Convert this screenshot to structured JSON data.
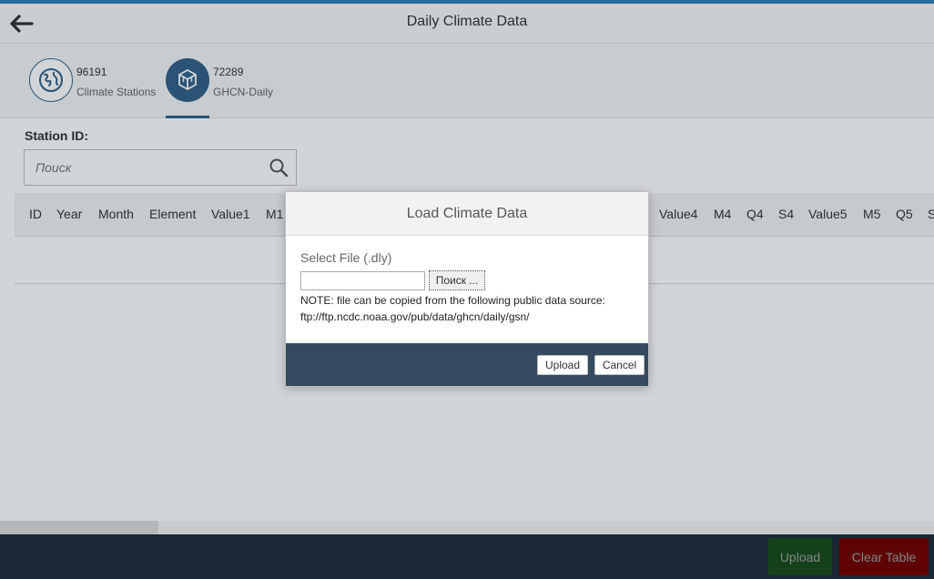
{
  "header": {
    "title": "Daily Climate Data",
    "back_icon": "arrow-left-icon"
  },
  "tabs": [
    {
      "count": "96191",
      "label": "Climate Stations",
      "icon": "globe-icon",
      "selected": false
    },
    {
      "count": "72289",
      "label": "GHCN-Daily",
      "icon": "cube-icon",
      "selected": true
    }
  ],
  "search": {
    "label": "Station ID:",
    "placeholder": "Поиск",
    "value": "",
    "icon": "search-icon"
  },
  "table": {
    "columns": [
      "ID",
      "Year",
      "Month",
      "Element",
      "Value1",
      "M1",
      "Value4",
      "M4",
      "Q4",
      "S4",
      "Value5",
      "M5",
      "Q5",
      "S"
    ],
    "rows": []
  },
  "footer": {
    "upload_label": "Upload",
    "clear_label": "Clear Table"
  },
  "dialog": {
    "title": "Load Climate Data",
    "file_label": "Select File (.dly)",
    "browse_label": "Поиск ...",
    "note_line1": "NOTE: file can be copied from the following public data source:",
    "note_line2": "ftp://ftp.ncdc.noaa.gov/pub/data/ghcn/daily/gsn/",
    "upload_label": "Upload",
    "cancel_label": "Cancel"
  },
  "colors": {
    "accent": "#346187",
    "upload_green": "#2b7d2b",
    "clear_red": "#bb0000",
    "footer_bar": "#354a5f"
  }
}
